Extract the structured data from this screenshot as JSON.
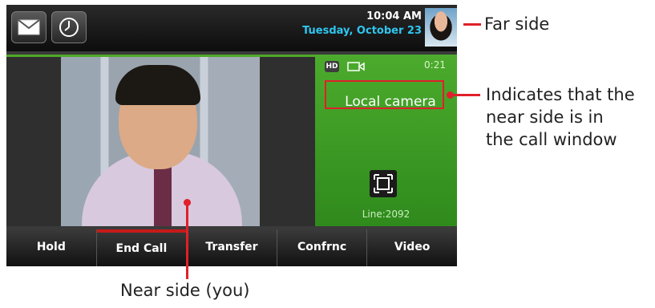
{
  "topbar": {
    "time": "10:04 AM",
    "date": "Tuesday, October 23",
    "icons": [
      "mail-icon",
      "clock-icon"
    ]
  },
  "call": {
    "timer": "0:21",
    "hd_badge": "HD",
    "local_label": "Local camera",
    "line": "Line:2092"
  },
  "softkeys": [
    "Hold",
    "End Call",
    "Transfer",
    "Confrnc",
    "Video"
  ],
  "annotations": {
    "far_side": "Far side",
    "indicates": [
      "Indicates that the",
      "near side is in",
      "the call window"
    ],
    "near_side": "Near side (you)"
  },
  "colors": {
    "accent_green": "#4cab2d",
    "date_cyan": "#2ec6f0",
    "annotation_red": "#e0202a"
  }
}
